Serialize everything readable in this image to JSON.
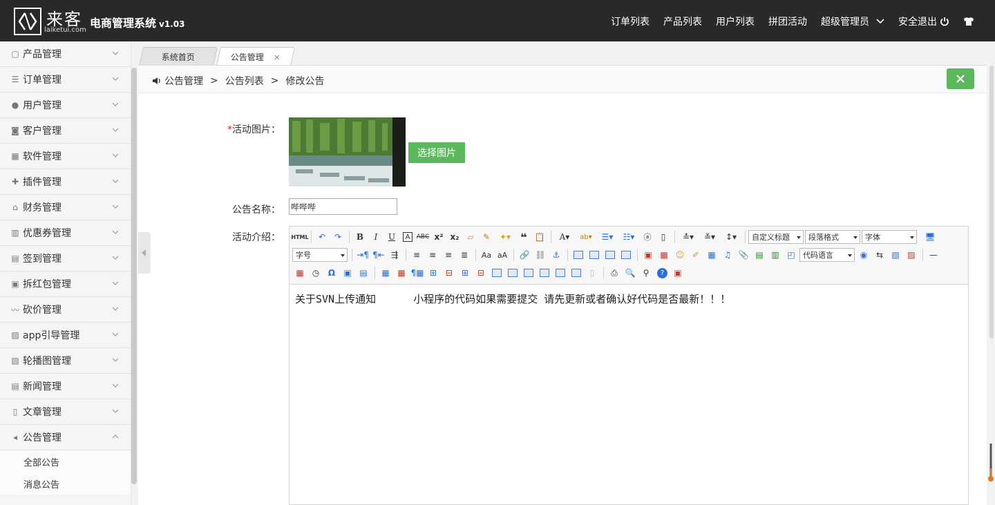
{
  "header": {
    "logo_cn": "来客",
    "logo_en": "laiketui.com",
    "system_title": "电商管理系统",
    "version": "v1.03",
    "nav": [
      "订单列表",
      "产品列表",
      "用户列表",
      "拼团活动"
    ],
    "admin_label": "超级管理员",
    "logout_label": "安全退出"
  },
  "sidebar": {
    "items": [
      {
        "label": "产品管理",
        "icon": "box-icon"
      },
      {
        "label": "订单管理",
        "icon": "list-icon"
      },
      {
        "label": "用户管理",
        "icon": "user-icon"
      },
      {
        "label": "客户管理",
        "icon": "customer-icon"
      },
      {
        "label": "软件管理",
        "icon": "grid-icon"
      },
      {
        "label": "插件管理",
        "icon": "puzzle-icon"
      },
      {
        "label": "财务管理",
        "icon": "bank-icon"
      },
      {
        "label": "优惠券管理",
        "icon": "coupon-icon"
      },
      {
        "label": "签到管理",
        "icon": "checkin-icon"
      },
      {
        "label": "拆红包管理",
        "icon": "redpacket-icon"
      },
      {
        "label": "砍价管理",
        "icon": "trend-icon"
      },
      {
        "label": "app引导管理",
        "icon": "image-icon"
      },
      {
        "label": "轮播图管理",
        "icon": "image-icon"
      },
      {
        "label": "新闻管理",
        "icon": "news-icon"
      },
      {
        "label": "文章管理",
        "icon": "file-icon"
      },
      {
        "label": "公告管理",
        "icon": "speaker-icon"
      }
    ],
    "sub_items": [
      "全部公告",
      "消息公告"
    ]
  },
  "tabs": [
    {
      "label": "系统首页"
    },
    {
      "label": "公告管理",
      "close": "×"
    }
  ],
  "breadcrumb": [
    "公告管理",
    "公告列表",
    "修改公告"
  ],
  "breadcrumb_sep": ">",
  "form": {
    "image_label": "活动图片：",
    "required_mark": "*",
    "pick_image_button": "选择图片",
    "name_label": "公告名称：",
    "name_value": "哔哔哔",
    "intro_label": "活动介绍："
  },
  "editor": {
    "selects": {
      "custom_title": "自定义标题",
      "paragraph": "段落格式",
      "font": "字体",
      "font_size": "字号",
      "code_lang": "代码语言"
    },
    "content": "关于SVN上传通知      小程序的代码如果需要提交 请先更新或者确认好代码是否最新！！！"
  },
  "colors": {
    "header_bg": "#292929",
    "accent_green": "#5cb85c",
    "required_red": "#e02020"
  }
}
